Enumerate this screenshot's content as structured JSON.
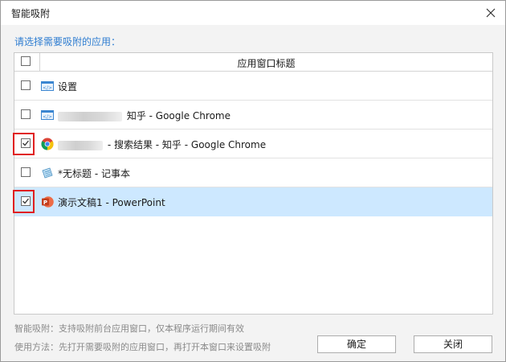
{
  "window": {
    "title": "智能吸附"
  },
  "instruction": "请选择需要吸附的应用：",
  "table": {
    "header_title": "应用窗口标题",
    "rows": [
      {
        "checked": false,
        "icon": "settings-app-icon",
        "text": "设置",
        "selected": false
      },
      {
        "checked": false,
        "icon": "settings-app-icon",
        "text": "知乎 - Google Chrome",
        "selected": false
      },
      {
        "checked": true,
        "icon": "chrome-icon",
        "text": "- 搜索结果 - 知乎 - Google Chrome",
        "selected": false
      },
      {
        "checked": false,
        "icon": "notepad-icon",
        "text": "*无标题 - 记事本",
        "selected": false
      },
      {
        "checked": true,
        "icon": "powerpoint-icon",
        "text": "演示文稿1 - PowerPoint",
        "selected": true
      }
    ]
  },
  "footer": {
    "note1": "智能吸附：支持吸附前台应用窗口，仅本程序运行期间有效",
    "note2": "使用方法：先打开需要吸附的应用窗口，再打开本窗口来设置吸附"
  },
  "buttons": {
    "ok": "确定",
    "close": "关闭"
  },
  "colors": {
    "accent": "#2f7dd1",
    "selection": "#cde8ff",
    "highlight": "#e02020"
  }
}
